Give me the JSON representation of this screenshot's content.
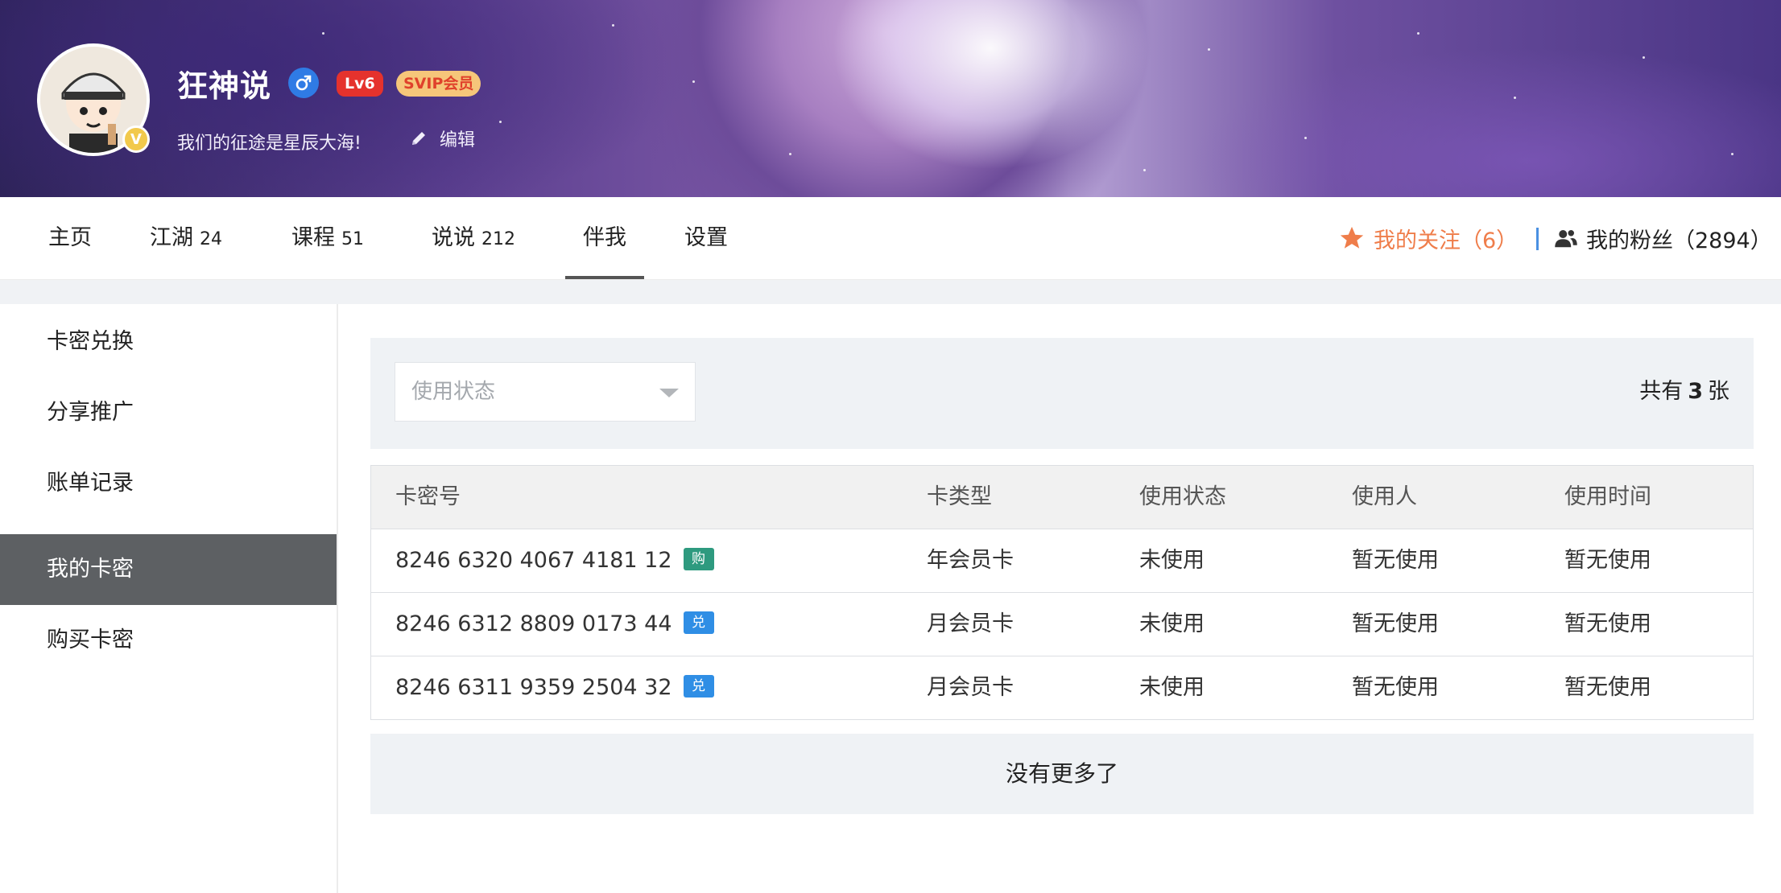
{
  "profile": {
    "username": "狂神说",
    "level": "Lv6",
    "svip": "SVIP会员",
    "verified": "V",
    "motto": "我们的征途是星辰大海!",
    "edit_label": "编辑"
  },
  "nav": {
    "tabs": [
      {
        "label": "主页",
        "count": ""
      },
      {
        "label": "江湖",
        "count": "24"
      },
      {
        "label": "课程",
        "count": "51"
      },
      {
        "label": "说说",
        "count": "212"
      },
      {
        "label": "伴我",
        "count": ""
      },
      {
        "label": "设置",
        "count": ""
      }
    ],
    "active_tab": "伴我",
    "following": "我的关注（6）",
    "fans": "我的粉丝（2894）"
  },
  "sidebar": {
    "items": [
      {
        "label": "卡密兑换"
      },
      {
        "label": "分享推广"
      },
      {
        "label": "账单记录"
      },
      {
        "label": "我的卡密"
      },
      {
        "label": "购买卡密"
      }
    ],
    "active": "我的卡密"
  },
  "filter": {
    "status_placeholder": "使用状态",
    "total_prefix": "共有",
    "total_count": "3",
    "total_suffix": "张"
  },
  "table": {
    "headers": [
      "卡密号",
      "卡类型",
      "使用状态",
      "使用人",
      "使用时间"
    ],
    "rows": [
      {
        "card_no": "8246 6320 4067 4181 12",
        "tag": "购",
        "type": "年会员卡",
        "status": "未使用",
        "user": "暂无使用",
        "time": "暂无使用"
      },
      {
        "card_no": "8246 6312 8809 0173 44",
        "tag": "兑",
        "type": "月会员卡",
        "status": "未使用",
        "user": "暂无使用",
        "time": "暂无使用"
      },
      {
        "card_no": "8246 6311 9359 2504 32",
        "tag": "兑",
        "type": "月会员卡",
        "status": "未使用",
        "user": "暂无使用",
        "time": "暂无使用"
      }
    ]
  },
  "footer": {
    "no_more": "没有更多了"
  },
  "colors": {
    "accent_follow": "#ef7d4a",
    "sidebar_active": "#5d6063",
    "tag_buy": "#2e9a7f",
    "tag_exchange": "#2f8ee5",
    "level_badge": "#e5322d",
    "gender_male": "#2f7be5"
  }
}
